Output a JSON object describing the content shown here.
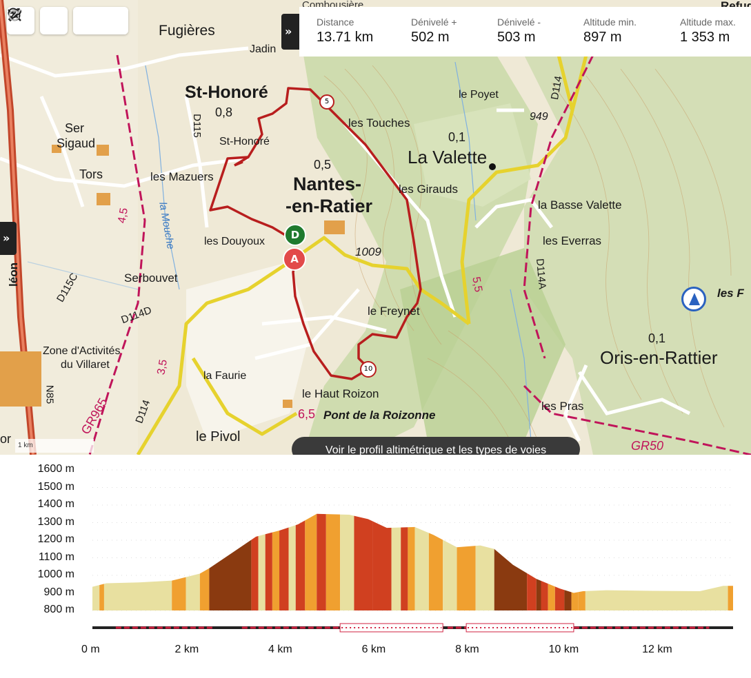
{
  "toolbar": {
    "buttons": [
      {
        "name": "zoom-search-button",
        "icon": "magnifier-icon"
      },
      {
        "name": "settings-button",
        "icon": "wrench-icon"
      },
      {
        "name": "undo-button",
        "icon": "undo-icon"
      },
      {
        "name": "redo-button",
        "icon": "redo-icon"
      }
    ]
  },
  "stats": [
    {
      "label": "Distance",
      "value": "13.71 km"
    },
    {
      "label": "Dénivelé +",
      "value": "502 m"
    },
    {
      "label": "Dénivelé -",
      "value": "503 m"
    },
    {
      "label": "Altitude min.",
      "value": "897 m"
    },
    {
      "label": "Altitude max.",
      "value": "1 353 m"
    }
  ],
  "map": {
    "labels": {
      "fugieres": "Fugières",
      "jadin": "Jadin",
      "combo": "Combousière",
      "sthonore": "St-Honoré",
      "sthonore_small": "St-Honoré",
      "v08": "0,8",
      "ser": "Ser",
      "sigaud": "Sigaud",
      "tors": "Tors",
      "mazuers": "les Mazuers",
      "v05": "0,5",
      "nantes1": "Nantes-",
      "nantes2": "-en-Ratier",
      "douyoux": "les Douyoux",
      "serbouvet": "Serbouvet",
      "freynet": "le Freynet",
      "touches": "les Touches",
      "poyet": "le Poyet",
      "v01a": "0,1",
      "valette": "La Valette",
      "giraud": "les Girauds",
      "bassevalette": "la Basse Valette",
      "everras": "les Everras",
      "lesf": "les F",
      "v01b": "0,1",
      "oris": "Oris-en-Rattier",
      "pras": "les Pras",
      "alt949": "949",
      "alt1009": "1009",
      "zone1": "Zone d'Activités",
      "zone2": "du Villaret",
      "faurie": "la Faurie",
      "hautroizon": "le Haut Roizon",
      "pontroiz": "Pont de la Roizonne",
      "v65": "6,5",
      "pivol": "le Pivol",
      "gr965": "GR965",
      "gr50": "GR50",
      "d115c": "D115C",
      "d114d": "D114D",
      "d114": "D114",
      "d114a": "D114A",
      "d114b": "D114",
      "d115": "D115",
      "n85": "N85",
      "mouche": "la Mouche",
      "v45": "4,5",
      "v35": "3,5",
      "v55": "5,5",
      "leon": "léon",
      "or": "or",
      "refuge": "Refug"
    },
    "markers": {
      "start": "D",
      "end": "A",
      "km5": "5",
      "km10": "10"
    },
    "scale": "1 km",
    "profile_button": "Voir le profil altimétrique et les types de voies"
  },
  "chart_data": {
    "type": "area",
    "title": "",
    "xlabel": "",
    "ylabel": "",
    "xlim": [
      0,
      13.71
    ],
    "ylim": [
      800,
      1600
    ],
    "y_ticks": [
      "1600 m",
      "1500 m",
      "1400 m",
      "1300 m",
      "1200 m",
      "1100 m",
      "1000 m",
      "900 m",
      "800 m"
    ],
    "x_ticks": [
      "0 m",
      "2 km",
      "4 km",
      "6 km",
      "8 km",
      "10 km",
      "12 km"
    ],
    "x": [
      0,
      0.3,
      1.0,
      1.7,
      2.3,
      2.5,
      3.0,
      3.5,
      4.0,
      4.4,
      4.8,
      5.5,
      5.9,
      6.3,
      6.9,
      7.3,
      7.8,
      8.3,
      8.6,
      9.0,
      9.5,
      10.0,
      10.3,
      10.5,
      11.0,
      12.0,
      13.0,
      13.5,
      13.71
    ],
    "values": [
      935,
      955,
      960,
      970,
      1010,
      1040,
      1130,
      1220,
      1255,
      1290,
      1350,
      1345,
      1320,
      1270,
      1275,
      1230,
      1160,
      1170,
      1150,
      1060,
      980,
      925,
      900,
      910,
      915,
      912,
      910,
      940,
      940
    ],
    "colors": {
      "paved": "#e8e0a0",
      "track": "#f0a030",
      "path": "#d04020",
      "trail": "#8a3a10"
    },
    "line_type_bar": true
  }
}
